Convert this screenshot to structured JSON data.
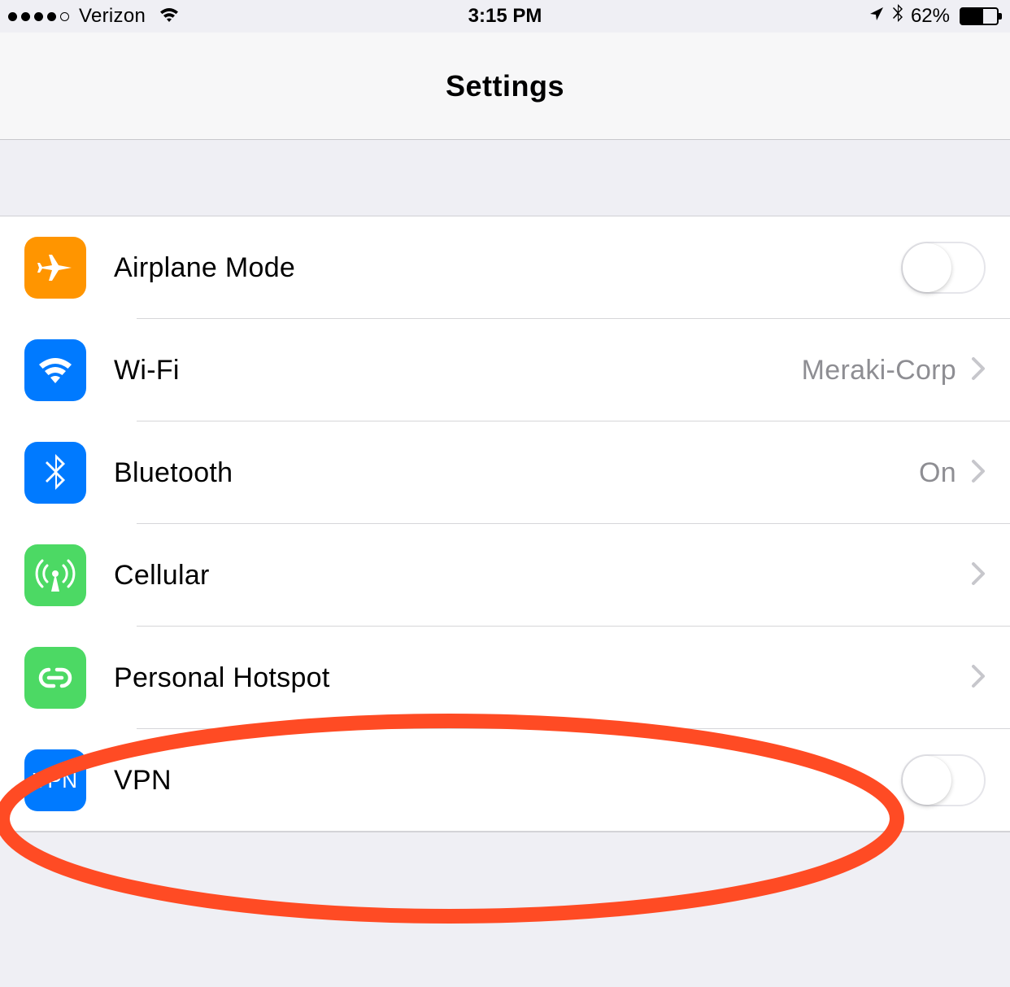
{
  "status": {
    "carrier": "Verizon",
    "time": "3:15 PM",
    "battery": "62%"
  },
  "header": {
    "title": "Settings"
  },
  "rows": {
    "airplane": {
      "label": "Airplane Mode"
    },
    "wifi": {
      "label": "Wi-Fi",
      "detail": "Meraki-Corp"
    },
    "bluetooth": {
      "label": "Bluetooth",
      "detail": "On"
    },
    "cellular": {
      "label": "Cellular"
    },
    "hotspot": {
      "label": "Personal Hotspot"
    },
    "vpn": {
      "label": "VPN",
      "iconText": "VPN"
    }
  },
  "colors": {
    "orange": "#ff9500",
    "blue": "#007aff",
    "green": "#4cd964",
    "annotation": "#ff4b24"
  }
}
